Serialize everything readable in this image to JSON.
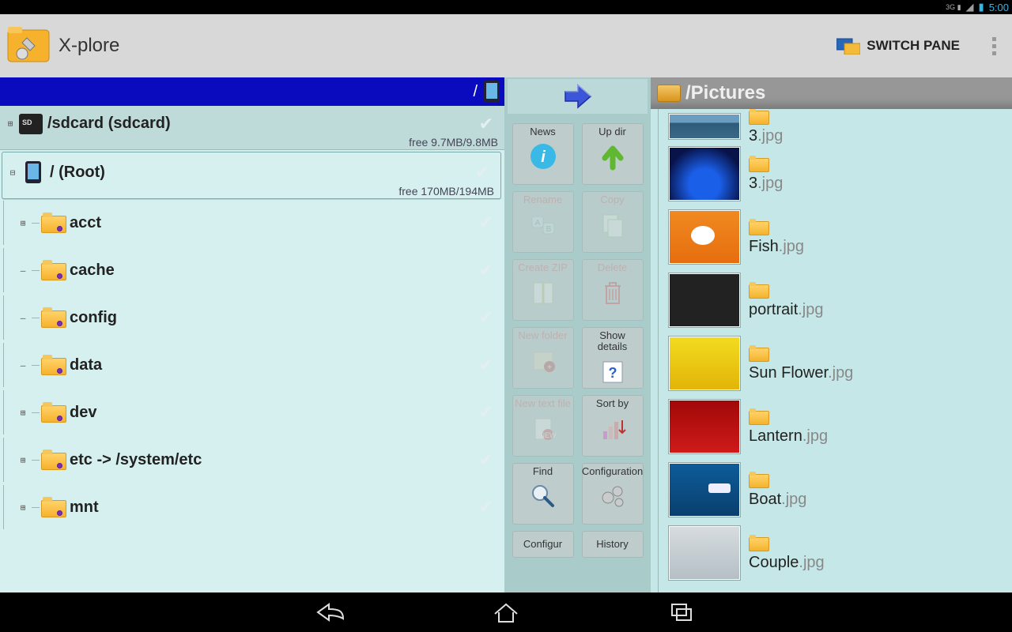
{
  "status": {
    "net": "3G",
    "time": "5:00"
  },
  "app": {
    "title": "X-plore",
    "switch": "SWITCH PANE"
  },
  "left": {
    "path": "/",
    "sd": {
      "label": "/sdcard (sdcard)",
      "free": "free 9.7MB/9.8MB"
    },
    "root": {
      "label": "/ (Root)",
      "free": "free 170MB/194MB"
    },
    "items": [
      {
        "label": "acct",
        "exp": "⊞"
      },
      {
        "label": "cache",
        "exp": "–"
      },
      {
        "label": "config",
        "exp": "–"
      },
      {
        "label": "data",
        "exp": "–"
      },
      {
        "label": "dev",
        "exp": "⊞"
      },
      {
        "label": "etc -> /system/etc",
        "exp": "⊞"
      },
      {
        "label": "mnt",
        "exp": "⊞"
      }
    ]
  },
  "tools": [
    [
      {
        "k": "news",
        "label": "News",
        "enabled": true
      },
      {
        "k": "updir",
        "label": "Up dir",
        "enabled": true
      }
    ],
    [
      {
        "k": "rename",
        "label": "Rename",
        "enabled": false
      },
      {
        "k": "copy",
        "label": "Copy",
        "enabled": false
      }
    ],
    [
      {
        "k": "zip",
        "label": "Create ZIP",
        "enabled": false
      },
      {
        "k": "delete",
        "label": "Delete",
        "enabled": false
      }
    ],
    [
      {
        "k": "newfolder",
        "label": "New folder",
        "enabled": false
      },
      {
        "k": "details",
        "label": "Show details",
        "enabled": true
      }
    ],
    [
      {
        "k": "newtext",
        "label": "New text file",
        "enabled": false
      },
      {
        "k": "sort",
        "label": "Sort by",
        "enabled": true
      }
    ],
    [
      {
        "k": "find",
        "label": "Find",
        "enabled": true
      },
      {
        "k": "config",
        "label": "Configuration",
        "enabled": true
      }
    ],
    [
      {
        "k": "config2",
        "label": "Configur",
        "enabled": true
      },
      {
        "k": "history",
        "label": "History",
        "enabled": true
      }
    ]
  ],
  "right": {
    "path": "/Pictures",
    "files": [
      {
        "name": "3",
        "ext": ".jpg",
        "th": "t-lake",
        "first": true
      },
      {
        "name": "3",
        "ext": ".jpg",
        "th": "t-bridge"
      },
      {
        "name": "Fish",
        "ext": ".jpg",
        "th": "t-fish"
      },
      {
        "name": "portrait",
        "ext": ".jpg",
        "th": "t-portrait"
      },
      {
        "name": "Sun Flower",
        "ext": ".jpg",
        "th": "t-sun"
      },
      {
        "name": "Lantern",
        "ext": ".jpg",
        "th": "t-lantern"
      },
      {
        "name": "Boat",
        "ext": ".jpg",
        "th": "t-boat"
      },
      {
        "name": "Couple",
        "ext": ".jpg",
        "th": "t-couple"
      }
    ]
  }
}
